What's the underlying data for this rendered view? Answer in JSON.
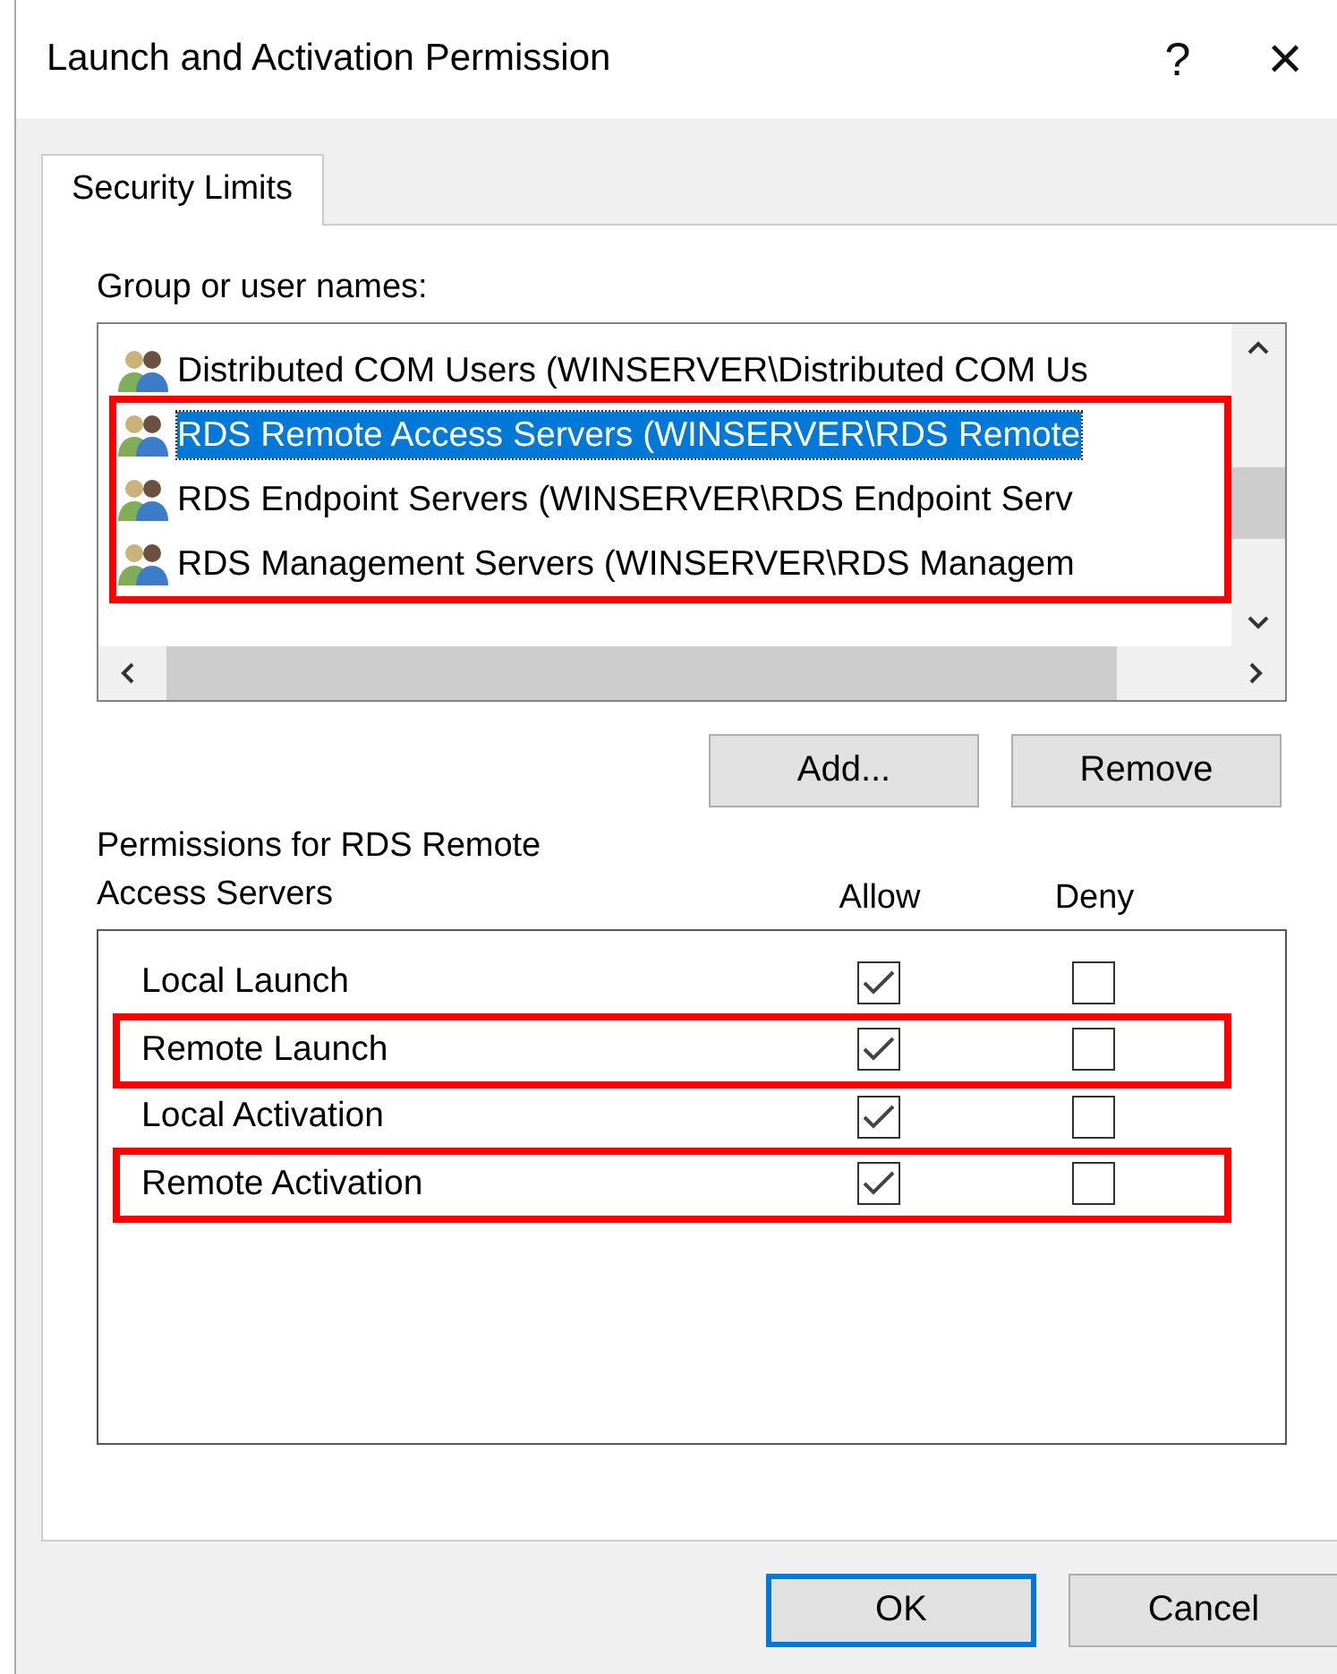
{
  "window": {
    "title": "Launch and Activation Permission",
    "help": "?",
    "close": "×"
  },
  "tabs": [
    {
      "label": "Security Limits",
      "selected": true
    }
  ],
  "group_label": "Group or user names:",
  "users": [
    {
      "name": "Distributed COM Users (WINSERVER\\Distributed COM Us",
      "selected": false,
      "highlighted": false
    },
    {
      "name": "RDS Remote Access Servers (WINSERVER\\RDS Remote",
      "selected": true,
      "highlighted": true
    },
    {
      "name": "RDS Endpoint Servers (WINSERVER\\RDS Endpoint Serv",
      "selected": false,
      "highlighted": true
    },
    {
      "name": "RDS Management Servers (WINSERVER\\RDS Managem",
      "selected": false,
      "highlighted": true
    }
  ],
  "list_buttons": [
    "Add...",
    "Remove"
  ],
  "permissions_label": "Permissions for RDS Remote Access Servers",
  "columns": [
    "Allow",
    "Deny"
  ],
  "permissions": [
    {
      "name": "Local Launch",
      "allow": true,
      "deny": false,
      "highlighted": false
    },
    {
      "name": "Remote Launch",
      "allow": true,
      "deny": false,
      "highlighted": true
    },
    {
      "name": "Local Activation",
      "allow": true,
      "deny": false,
      "highlighted": false
    },
    {
      "name": "Remote Activation",
      "allow": true,
      "deny": false,
      "highlighted": true
    }
  ],
  "buttons": [
    {
      "label": "OK",
      "default": true
    },
    {
      "label": "Cancel",
      "default": false
    }
  ]
}
